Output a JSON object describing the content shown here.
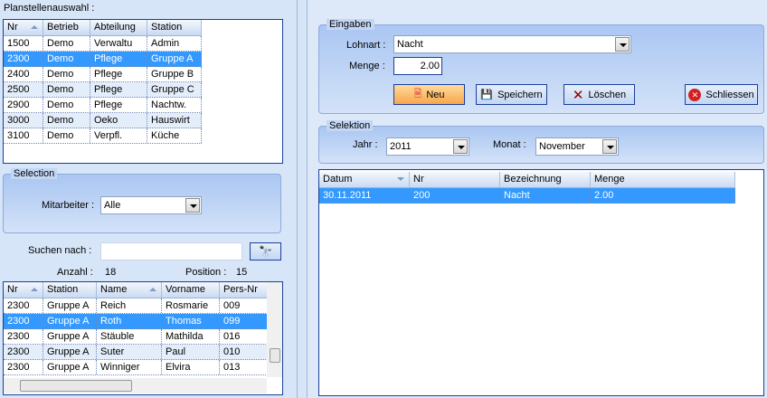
{
  "left": {
    "title": "Planstellenauswahl :",
    "planstellen": {
      "columns": [
        "Nr",
        "Betrieb",
        "Abteilung",
        "Station"
      ],
      "rows": [
        [
          "1500",
          "Demo",
          "Verwaltu",
          "Admin"
        ],
        [
          "2300",
          "Demo",
          "Pflege",
          "Gruppe A"
        ],
        [
          "2400",
          "Demo",
          "Pflege",
          "Gruppe B"
        ],
        [
          "2500",
          "Demo",
          "Pflege",
          "Gruppe C"
        ],
        [
          "2900",
          "Demo",
          "Pflege",
          "Nachtw."
        ],
        [
          "3000",
          "Demo",
          "Oeko",
          "Hauswirt"
        ],
        [
          "3100",
          "Demo",
          "Verpfl.",
          "Küche"
        ]
      ],
      "selected": 1
    },
    "selection": {
      "title": "Selection",
      "mitarbeiter_label": "Mitarbeiter :",
      "mitarbeiter_value": "Alle"
    },
    "search": {
      "label": "Suchen nach :",
      "value": "",
      "anzahl_label": "Anzahl :",
      "anzahl": "18",
      "position_label": "Position :",
      "position": "15"
    },
    "mitarbeiter": {
      "columns": [
        "Nr",
        "Station",
        "Name",
        "Vorname",
        "Pers-Nr"
      ],
      "rows": [
        [
          "2300",
          "Gruppe A",
          "Reich",
          "Rosmarie",
          "009"
        ],
        [
          "2300",
          "Gruppe A",
          "Roth",
          "Thomas",
          "099"
        ],
        [
          "2300",
          "Gruppe A",
          "Stäuble",
          "Mathilda",
          "016"
        ],
        [
          "2300",
          "Gruppe A",
          "Suter",
          "Paul",
          "010"
        ],
        [
          "2300",
          "Gruppe A",
          "Winniger",
          "Elvira",
          "013"
        ]
      ],
      "selected": 1
    }
  },
  "right": {
    "eingaben": {
      "title": "Eingaben",
      "lohnart_label": "Lohnart :",
      "lohnart": "Nacht",
      "menge_label": "Menge :",
      "menge": "2.00",
      "buttons": {
        "neu": "Neu",
        "speichern": "Speichern",
        "loeschen": "Löschen",
        "schliessen": "Schliessen"
      }
    },
    "selektion": {
      "title": "Selektion",
      "jahr_label": "Jahr :",
      "jahr": "2011",
      "monat_label": "Monat :",
      "monat": "November"
    },
    "grid": {
      "columns": [
        "Datum",
        "Nr",
        "Bezeichnung",
        "Menge"
      ],
      "rows": [
        [
          "30.11.2011",
          "200",
          "Nacht",
          "2.00"
        ]
      ],
      "selected": 0
    }
  }
}
